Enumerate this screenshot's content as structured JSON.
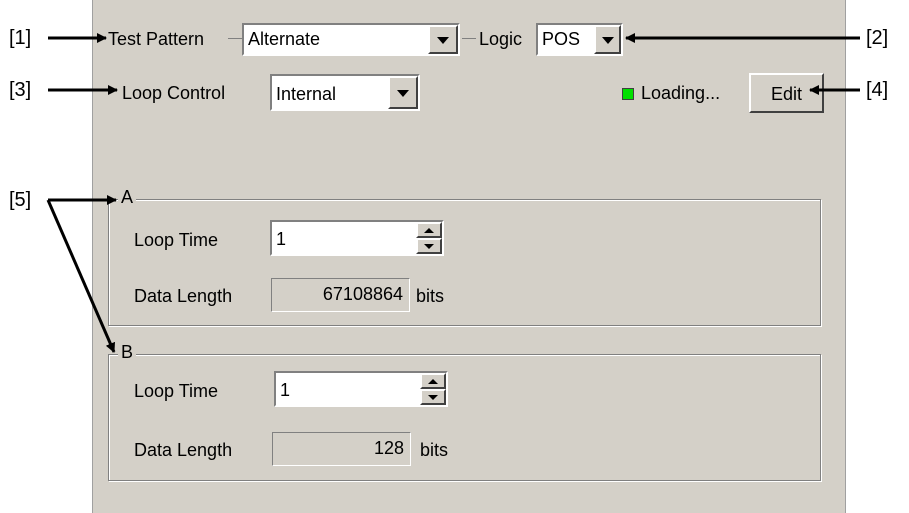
{
  "callouts": {
    "c1": "[1]",
    "c2": "[2]",
    "c3": "[3]",
    "c4": "[4]",
    "c5": "[5]"
  },
  "test_pattern": {
    "label": "Test Pattern",
    "value": "Alternate"
  },
  "logic": {
    "label": "Logic",
    "value": "POS"
  },
  "loop_control": {
    "label": "Loop Control",
    "value": "Internal"
  },
  "status": {
    "text": "Loading...",
    "led_color": "#00e000"
  },
  "edit_button": {
    "label": "Edit"
  },
  "group_a": {
    "title": "A",
    "loop_time_label": "Loop Time",
    "loop_time_value": "1",
    "data_length_label": "Data Length",
    "data_length_value": "67108864",
    "unit": "bits"
  },
  "group_b": {
    "title": "B",
    "loop_time_label": "Loop Time",
    "loop_time_value": "1",
    "data_length_label": "Data Length",
    "data_length_value": "128",
    "unit": "bits"
  }
}
